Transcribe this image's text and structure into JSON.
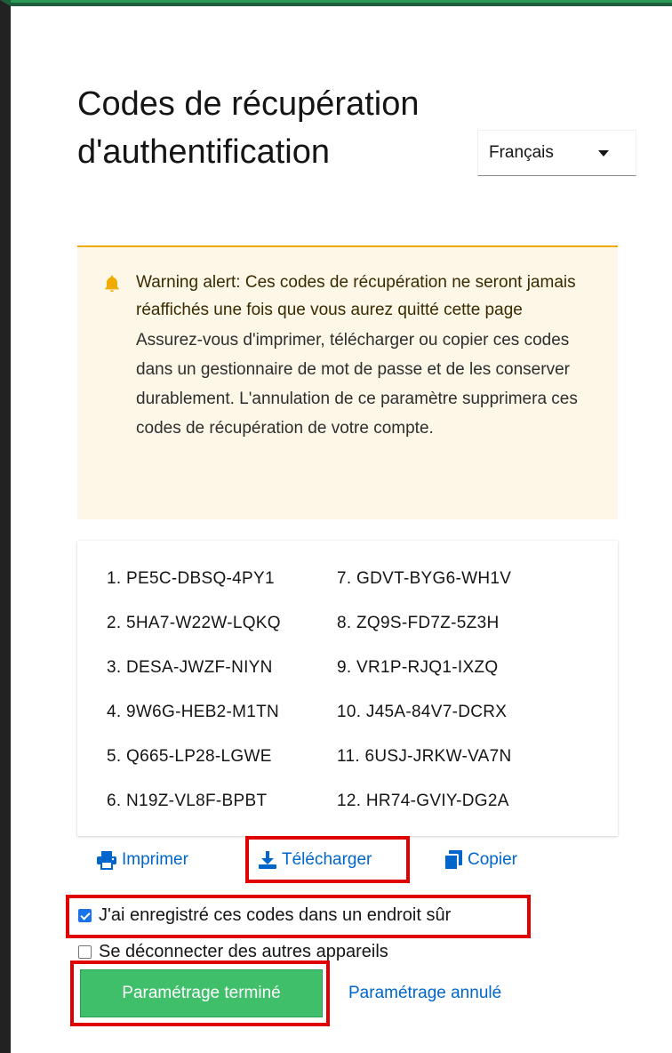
{
  "page": {
    "title": "Codes de récupération d'authentification"
  },
  "language_select": {
    "selected": "Français"
  },
  "alert": {
    "icon": "bell-icon",
    "title": "Warning alert: Ces codes de récupération ne seront jamais réaffichés une fois que vous aurez quitté cette page",
    "body": "Assurez-vous d'imprimer, télécharger ou copier ces codes dans un gestionnaire de mot de passe et de les conserver durablement. L'annulation de ce paramètre supprimera ces codes de récupération de votre compte.",
    "color": "#f0ab00"
  },
  "codes": {
    "left": [
      "1. PE5C-DBSQ-4PY1",
      "2. 5HA7-W22W-LQKQ",
      "3. DESA-JWZF-NIYN",
      "4. 9W6G-HEB2-M1TN",
      "5. Q665-LP28-LGWE",
      "6. N19Z-VL8F-BPBT"
    ],
    "right": [
      "7. GDVT-BYG6-WH1V",
      "8. ZQ9S-FD7Z-5Z3H",
      "9. VR1P-RJQ1-IXZQ",
      "10. J45A-84V7-DCRX",
      "11. 6USJ-JRKW-VA7N",
      "12. HR74-GVIY-DG2A"
    ]
  },
  "actions": {
    "print_label": "Imprimer",
    "download_label": "Télécharger",
    "copy_label": "Copier",
    "link_color": "#0066cc"
  },
  "checkboxes": {
    "saved": {
      "label": "J'ai enregistré ces codes dans un endroit sûr",
      "checked": true
    },
    "logout": {
      "label": "Se déconnecter des autres appareils",
      "checked": false
    }
  },
  "buttons": {
    "done": "Paramétrage terminé",
    "cancel": "Paramétrage annulé",
    "done_color": "#3fbf6a"
  },
  "highlight_color": "#e00000"
}
